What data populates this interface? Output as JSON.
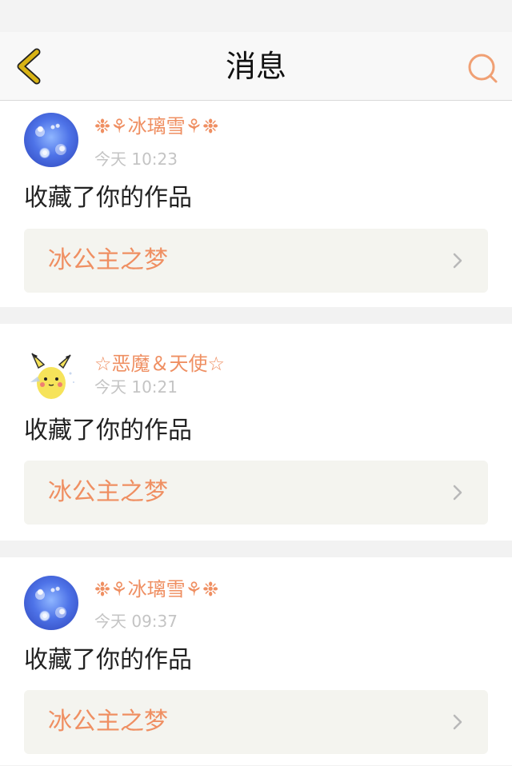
{
  "header": {
    "title": "消息",
    "back_icon": "chevron-left-icon",
    "search_icon": "search-icon"
  },
  "colors": {
    "accent": "#ef8f62",
    "back_icon": "#d8b315",
    "search_icon": "#f0a074",
    "card_bg": "#ffffff",
    "page_bg": "#f2f2f2",
    "work_bg": "#f4f4ef"
  },
  "messages": [
    {
      "username": "❉⚘冰璃雪⚘❉",
      "time": "今天 10:23",
      "action": "收藏了你的作品",
      "work_title": "冰公主之梦",
      "avatar": "snowflake-avatar"
    },
    {
      "username": "☆恶魔＆天使☆",
      "time": "今天 10:21",
      "action": "收藏了你的作品",
      "work_title": "冰公主之梦",
      "avatar": "pikachu-avatar"
    },
    {
      "username": "❉⚘冰璃雪⚘❉",
      "time": "今天 09:37",
      "action": "收藏了你的作品",
      "work_title": "冰公主之梦",
      "avatar": "snowflake-avatar"
    }
  ]
}
